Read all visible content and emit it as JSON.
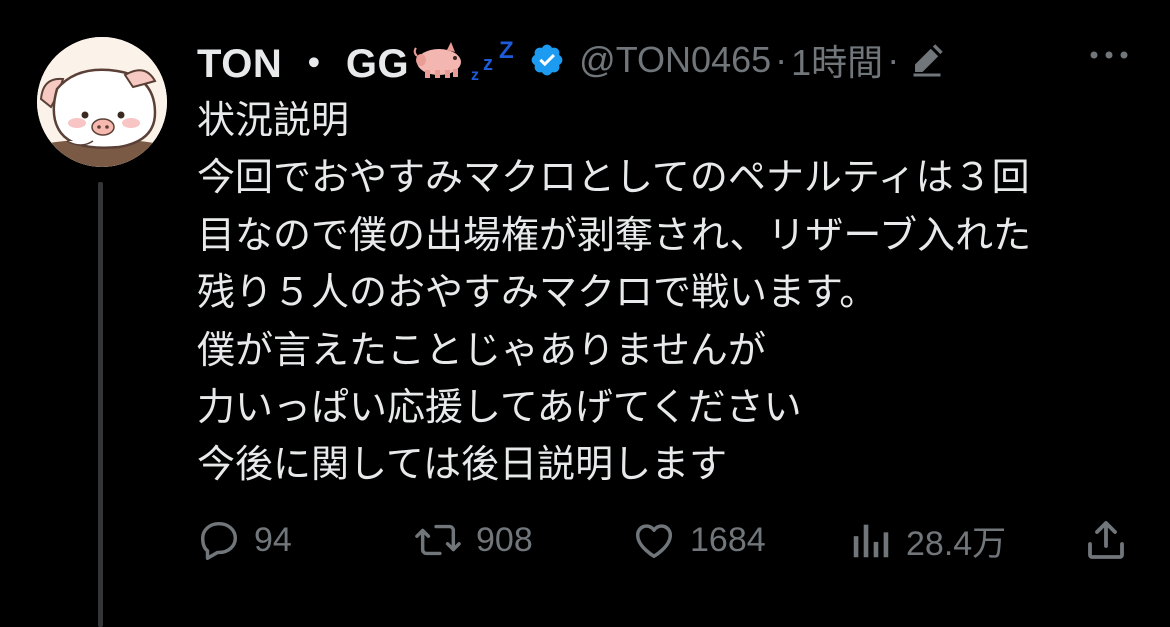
{
  "tweet": {
    "display_name": "TON ・ GG",
    "handle": "@TON0465",
    "separator": "·",
    "time": "1時間",
    "body_lines": [
      "状況説明",
      "今回でおやすみマクロとしてのペナルティは３回",
      "目なので僕の出場権が剥奪され、リザーブ入れた",
      "残り５人のおやすみマクロで戦います。",
      "僕が言えたことじゃありませんが",
      "力いっぱい応援してあげてください",
      "今後に関しては後日説明します"
    ],
    "icons": {
      "name_emoji": [
        "pig-icon",
        "zzz-icon"
      ],
      "verified": "verified-badge-icon",
      "edit": "edit-pencil-icon",
      "more": "more-dots-icon"
    }
  },
  "actions": {
    "replies": {
      "icon": "reply-icon",
      "count": "94"
    },
    "retweets": {
      "icon": "retweet-icon",
      "count": "908"
    },
    "likes": {
      "icon": "heart-icon",
      "count": "1684"
    },
    "views": {
      "icon": "views-icon",
      "count": "28.4万"
    },
    "share": {
      "icon": "share-icon"
    }
  },
  "colors": {
    "background": "#000000",
    "text_primary": "#e7e9ea",
    "text_secondary": "#71767b",
    "verified_blue": "#1d9bf0",
    "zzz_blue": "#1d5bd8"
  }
}
